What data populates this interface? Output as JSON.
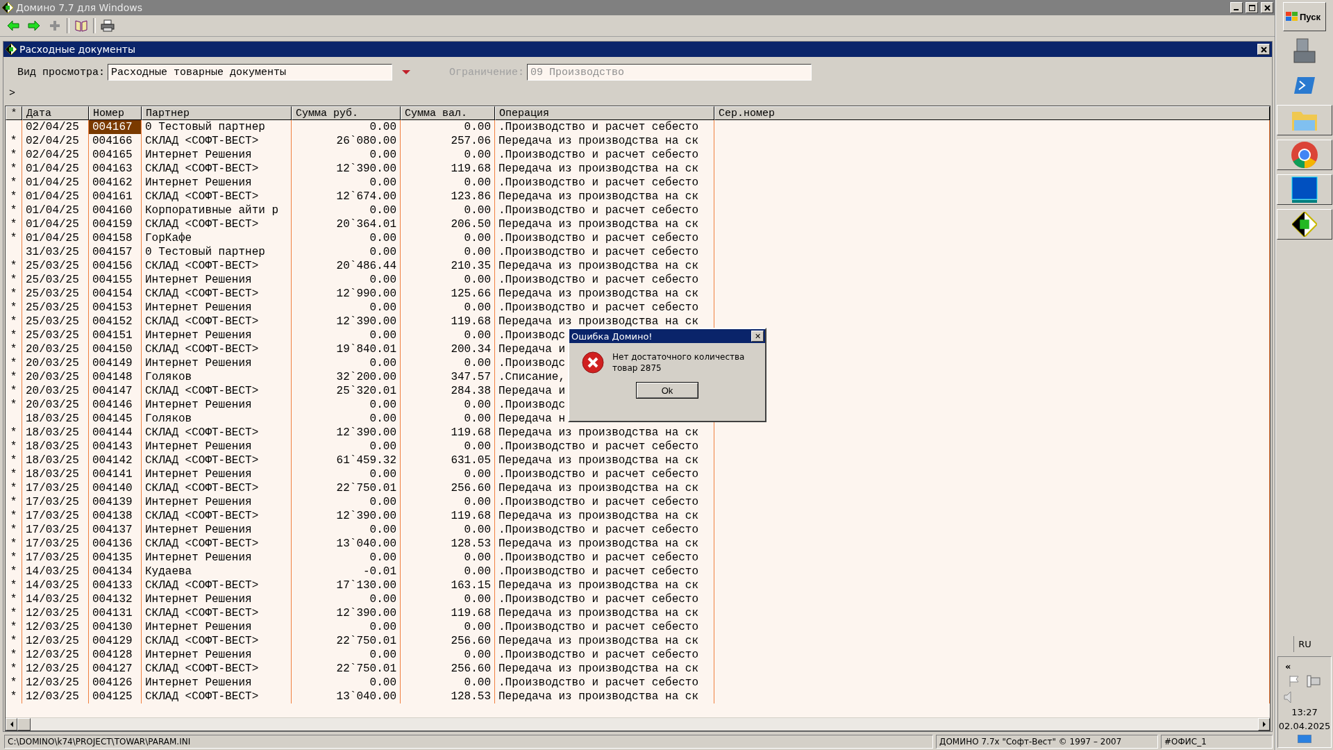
{
  "window": {
    "title": "Домино 7.7 для Windows"
  },
  "document": {
    "title": "Расходные документы",
    "view_label": "Вид просмотра:",
    "view_value": "Расходные товарные документы",
    "limit_label": "Ограничение:",
    "limit_value": "09 Производство",
    "prompt": ">"
  },
  "table": {
    "columns": [
      "*",
      "Дата",
      "Номер",
      "Партнер",
      "Сумма руб.",
      "Сумма вал.",
      "Операция",
      "Сер.номер"
    ],
    "rows": [
      {
        "mark": "",
        "date": "02/04/25",
        "number": "004167",
        "partner": "0 Тестовый партнер",
        "sum_rub": "0.00",
        "sum_val": "0.00",
        "operation": ".Производство и расчет себесто",
        "selected": true
      },
      {
        "mark": "*",
        "date": "02/04/25",
        "number": "004166",
        "partner": "СКЛАД <СОФТ-ВЕСТ>",
        "sum_rub": "26`080.00",
        "sum_val": "257.06",
        "operation": "Передача из производства на ск",
        "selected": false
      },
      {
        "mark": "*",
        "date": "02/04/25",
        "number": "004165",
        "partner": "Интернет Решения",
        "sum_rub": "0.00",
        "sum_val": "0.00",
        "operation": ".Производство и расчет себесто",
        "selected": false
      },
      {
        "mark": "*",
        "date": "01/04/25",
        "number": "004163",
        "partner": "СКЛАД <СОФТ-ВЕСТ>",
        "sum_rub": "12`390.00",
        "sum_val": "119.68",
        "operation": "Передача из производства на ск",
        "selected": false
      },
      {
        "mark": "*",
        "date": "01/04/25",
        "number": "004162",
        "partner": "Интернет Решения",
        "sum_rub": "0.00",
        "sum_val": "0.00",
        "operation": ".Производство и расчет себесто",
        "selected": false
      },
      {
        "mark": "*",
        "date": "01/04/25",
        "number": "004161",
        "partner": "СКЛАД <СОФТ-ВЕСТ>",
        "sum_rub": "12`674.00",
        "sum_val": "123.86",
        "operation": "Передача из производства на ск",
        "selected": false
      },
      {
        "mark": "*",
        "date": "01/04/25",
        "number": "004160",
        "partner": "Корпоративные айти р",
        "sum_rub": "0.00",
        "sum_val": "0.00",
        "operation": ".Производство и расчет себесто",
        "selected": false
      },
      {
        "mark": "*",
        "date": "01/04/25",
        "number": "004159",
        "partner": "СКЛАД <СОФТ-ВЕСТ>",
        "sum_rub": "20`364.01",
        "sum_val": "206.50",
        "operation": "Передача из производства на ск",
        "selected": false
      },
      {
        "mark": "*",
        "date": "01/04/25",
        "number": "004158",
        "partner": "ГорКафе",
        "sum_rub": "0.00",
        "sum_val": "0.00",
        "operation": ".Производство и расчет себесто",
        "selected": false
      },
      {
        "mark": "",
        "date": "31/03/25",
        "number": "004157",
        "partner": "0 Тестовый партнер",
        "sum_rub": "0.00",
        "sum_val": "0.00",
        "operation": ".Производство и расчет себесто",
        "selected": false
      },
      {
        "mark": "*",
        "date": "25/03/25",
        "number": "004156",
        "partner": "СКЛАД <СОФТ-ВЕСТ>",
        "sum_rub": "20`486.44",
        "sum_val": "210.35",
        "operation": "Передача из производства на ск",
        "selected": false
      },
      {
        "mark": "*",
        "date": "25/03/25",
        "number": "004155",
        "partner": "Интернет Решения",
        "sum_rub": "0.00",
        "sum_val": "0.00",
        "operation": ".Производство и расчет себесто",
        "selected": false
      },
      {
        "mark": "*",
        "date": "25/03/25",
        "number": "004154",
        "partner": "СКЛАД <СОФТ-ВЕСТ>",
        "sum_rub": "12`990.00",
        "sum_val": "125.66",
        "operation": "Передача из производства на ск",
        "selected": false
      },
      {
        "mark": "*",
        "date": "25/03/25",
        "number": "004153",
        "partner": "Интернет Решения",
        "sum_rub": "0.00",
        "sum_val": "0.00",
        "operation": ".Производство и расчет себесто",
        "selected": false
      },
      {
        "mark": "*",
        "date": "25/03/25",
        "number": "004152",
        "partner": "СКЛАД <СОФТ-ВЕСТ>",
        "sum_rub": "12`390.00",
        "sum_val": "119.68",
        "operation": "Передача из производства на ск",
        "selected": false
      },
      {
        "mark": "*",
        "date": "25/03/25",
        "number": "004151",
        "partner": "Интернет Решения",
        "sum_rub": "0.00",
        "sum_val": "0.00",
        "operation": ".Производс",
        "selected": false
      },
      {
        "mark": "*",
        "date": "20/03/25",
        "number": "004150",
        "partner": "СКЛАД <СОФТ-ВЕСТ>",
        "sum_rub": "19`840.01",
        "sum_val": "200.34",
        "operation": "Передача и",
        "selected": false
      },
      {
        "mark": "*",
        "date": "20/03/25",
        "number": "004149",
        "partner": "Интернет Решения",
        "sum_rub": "0.00",
        "sum_val": "0.00",
        "operation": ".Производс",
        "selected": false
      },
      {
        "mark": "*",
        "date": "20/03/25",
        "number": "004148",
        "partner": "Голяков",
        "sum_rub": "32`200.00",
        "sum_val": "347.57",
        "operation": ".Списание,",
        "selected": false
      },
      {
        "mark": "*",
        "date": "20/03/25",
        "number": "004147",
        "partner": "СКЛАД <СОФТ-ВЕСТ>",
        "sum_rub": "25`320.01",
        "sum_val": "284.38",
        "operation": "Передача и",
        "selected": false
      },
      {
        "mark": "*",
        "date": "20/03/25",
        "number": "004146",
        "partner": "Интернет Решения",
        "sum_rub": "0.00",
        "sum_val": "0.00",
        "operation": ".Производс",
        "selected": false
      },
      {
        "mark": "",
        "date": "18/03/25",
        "number": "004145",
        "partner": "Голяков",
        "sum_rub": "0.00",
        "sum_val": "0.00",
        "operation": "Передача н",
        "selected": false
      },
      {
        "mark": "*",
        "date": "18/03/25",
        "number": "004144",
        "partner": "СКЛАД <СОФТ-ВЕСТ>",
        "sum_rub": "12`390.00",
        "sum_val": "119.68",
        "operation": "Передача из производства на ск",
        "selected": false
      },
      {
        "mark": "*",
        "date": "18/03/25",
        "number": "004143",
        "partner": "Интернет Решения",
        "sum_rub": "0.00",
        "sum_val": "0.00",
        "operation": ".Производство и расчет себесто",
        "selected": false
      },
      {
        "mark": "*",
        "date": "18/03/25",
        "number": "004142",
        "partner": "СКЛАД <СОФТ-ВЕСТ>",
        "sum_rub": "61`459.32",
        "sum_val": "631.05",
        "operation": "Передача из производства на ск",
        "selected": false
      },
      {
        "mark": "*",
        "date": "18/03/25",
        "number": "004141",
        "partner": "Интернет Решения",
        "sum_rub": "0.00",
        "sum_val": "0.00",
        "operation": ".Производство и расчет себесто",
        "selected": false
      },
      {
        "mark": "*",
        "date": "17/03/25",
        "number": "004140",
        "partner": "СКЛАД <СОФТ-ВЕСТ>",
        "sum_rub": "22`750.01",
        "sum_val": "256.60",
        "operation": "Передача из производства на ск",
        "selected": false
      },
      {
        "mark": "*",
        "date": "17/03/25",
        "number": "004139",
        "partner": "Интернет Решения",
        "sum_rub": "0.00",
        "sum_val": "0.00",
        "operation": ".Производство и расчет себесто",
        "selected": false
      },
      {
        "mark": "*",
        "date": "17/03/25",
        "number": "004138",
        "partner": "СКЛАД <СОФТ-ВЕСТ>",
        "sum_rub": "12`390.00",
        "sum_val": "119.68",
        "operation": "Передача из производства на ск",
        "selected": false
      },
      {
        "mark": "*",
        "date": "17/03/25",
        "number": "004137",
        "partner": "Интернет Решения",
        "sum_rub": "0.00",
        "sum_val": "0.00",
        "operation": ".Производство и расчет себесто",
        "selected": false
      },
      {
        "mark": "*",
        "date": "17/03/25",
        "number": "004136",
        "partner": "СКЛАД <СОФТ-ВЕСТ>",
        "sum_rub": "13`040.00",
        "sum_val": "128.53",
        "operation": "Передача из производства на ск",
        "selected": false
      },
      {
        "mark": "*",
        "date": "17/03/25",
        "number": "004135",
        "partner": "Интернет Решения",
        "sum_rub": "0.00",
        "sum_val": "0.00",
        "operation": ".Производство и расчет себесто",
        "selected": false
      },
      {
        "mark": "*",
        "date": "14/03/25",
        "number": "004134",
        "partner": "Кудаева",
        "sum_rub": "-0.01",
        "sum_val": "0.00",
        "operation": ".Производство и расчет себесто",
        "selected": false
      },
      {
        "mark": "*",
        "date": "14/03/25",
        "number": "004133",
        "partner": "СКЛАД <СОФТ-ВЕСТ>",
        "sum_rub": "17`130.00",
        "sum_val": "163.15",
        "operation": "Передача из производства на ск",
        "selected": false
      },
      {
        "mark": "*",
        "date": "14/03/25",
        "number": "004132",
        "partner": "Интернет Решения",
        "sum_rub": "0.00",
        "sum_val": "0.00",
        "operation": ".Производство и расчет себесто",
        "selected": false
      },
      {
        "mark": "*",
        "date": "12/03/25",
        "number": "004131",
        "partner": "СКЛАД <СОФТ-ВЕСТ>",
        "sum_rub": "12`390.00",
        "sum_val": "119.68",
        "operation": "Передача из производства на ск",
        "selected": false
      },
      {
        "mark": "*",
        "date": "12/03/25",
        "number": "004130",
        "partner": "Интернет Решения",
        "sum_rub": "0.00",
        "sum_val": "0.00",
        "operation": ".Производство и расчет себесто",
        "selected": false
      },
      {
        "mark": "*",
        "date": "12/03/25",
        "number": "004129",
        "partner": "СКЛАД <СОФТ-ВЕСТ>",
        "sum_rub": "22`750.01",
        "sum_val": "256.60",
        "operation": "Передача из производства на ск",
        "selected": false
      },
      {
        "mark": "*",
        "date": "12/03/25",
        "number": "004128",
        "partner": "Интернет Решения",
        "sum_rub": "0.00",
        "sum_val": "0.00",
        "operation": ".Производство и расчет себесто",
        "selected": false
      },
      {
        "mark": "*",
        "date": "12/03/25",
        "number": "004127",
        "partner": "СКЛАД <СОФТ-ВЕСТ>",
        "sum_rub": "22`750.01",
        "sum_val": "256.60",
        "operation": "Передача из производства на ск",
        "selected": false
      },
      {
        "mark": "*",
        "date": "12/03/25",
        "number": "004126",
        "partner": "Интернет Решения",
        "sum_rub": "0.00",
        "sum_val": "0.00",
        "operation": ".Производство и расчет себесто",
        "selected": false
      },
      {
        "mark": "*",
        "date": "12/03/25",
        "number": "004125",
        "partner": "СКЛАД <СОФТ-ВЕСТ>",
        "sum_rub": "13`040.00",
        "sum_val": "128.53",
        "operation": "Передача из производства на ск",
        "selected": false
      }
    ]
  },
  "dialog": {
    "title": "Ошибка Домино!",
    "close": "✕",
    "message": "Нет достаточного количества товар 2875",
    "button": "Ok"
  },
  "status_bar": [
    "C:\\DOMINO\\k74\\PROJECT\\TOWAR\\PARAM.INI",
    "ДОМИНО 7.7x \"Софт-Вест\" © 1997 – 2007",
    "#ОФИС_1"
  ],
  "taskbar": {
    "start": "Пуск",
    "language": "RU",
    "tray_toggle": "«",
    "time": "13:27",
    "date": "02.04.2025"
  }
}
